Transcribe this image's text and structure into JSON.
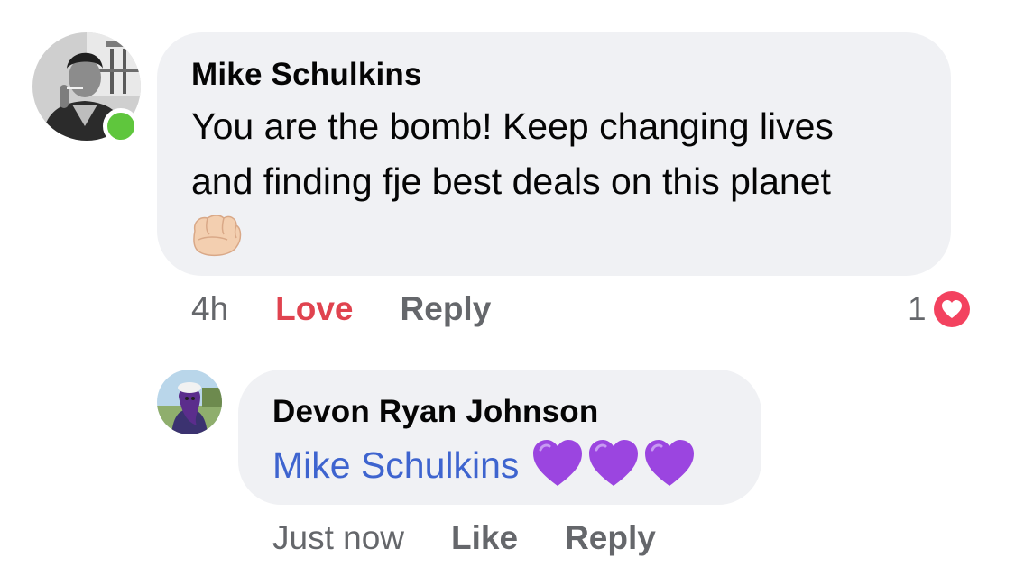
{
  "comment": {
    "author": "Mike Schulkins",
    "text": "You are the bomb! Keep changing lives\nand finding fje best deals on this planet",
    "emoji": "oncoming-fist-emoji",
    "online": true,
    "time": "4h",
    "reaction_label": "Love",
    "reply_label": "Reply",
    "reaction_count": "1",
    "reaction_icon": "love-reaction-icon",
    "colors": {
      "love": "#e0434f",
      "online": "#5fc63d",
      "bubble": "#f0f1f4"
    }
  },
  "reply": {
    "author": "Devon Ryan Johnson",
    "mention": "Mike Schulkins",
    "emoji": [
      "purple-heart-emoji",
      "purple-heart-emoji",
      "purple-heart-emoji"
    ],
    "time": "Just now",
    "like_label": "Like",
    "reply_label": "Reply",
    "colors": {
      "mention": "#3e64cf"
    }
  }
}
